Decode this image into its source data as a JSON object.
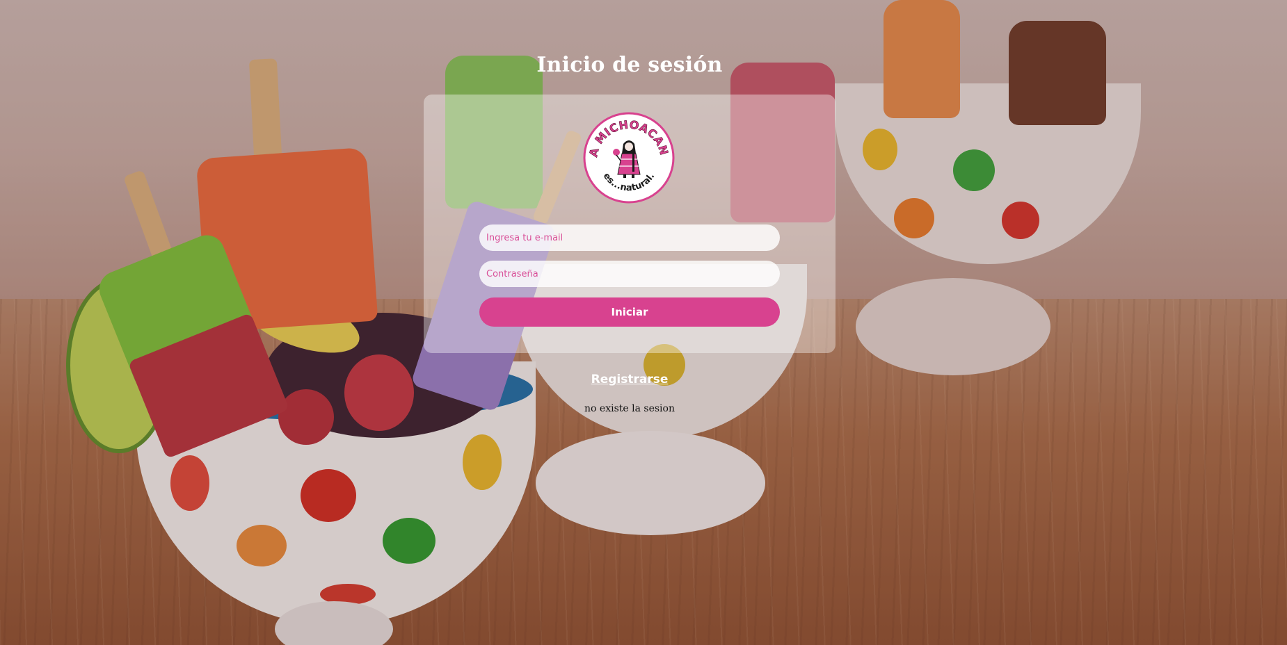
{
  "page": {
    "title": "Inicio de sesión"
  },
  "logo": {
    "top_text": "LA MICHOACANA",
    "bottom_text": "es...natural."
  },
  "form": {
    "email_placeholder": "Ingresa tu e-mail",
    "email_value": "",
    "password_placeholder": "Contraseña",
    "password_value": "",
    "submit_label": "Iniciar"
  },
  "register_link": "Registrarse",
  "status_message": "no existe la sesion",
  "colors": {
    "accent_pink": "#d8428f",
    "placeholder_pink": "#d94f98",
    "title_white": "#ffffff"
  }
}
